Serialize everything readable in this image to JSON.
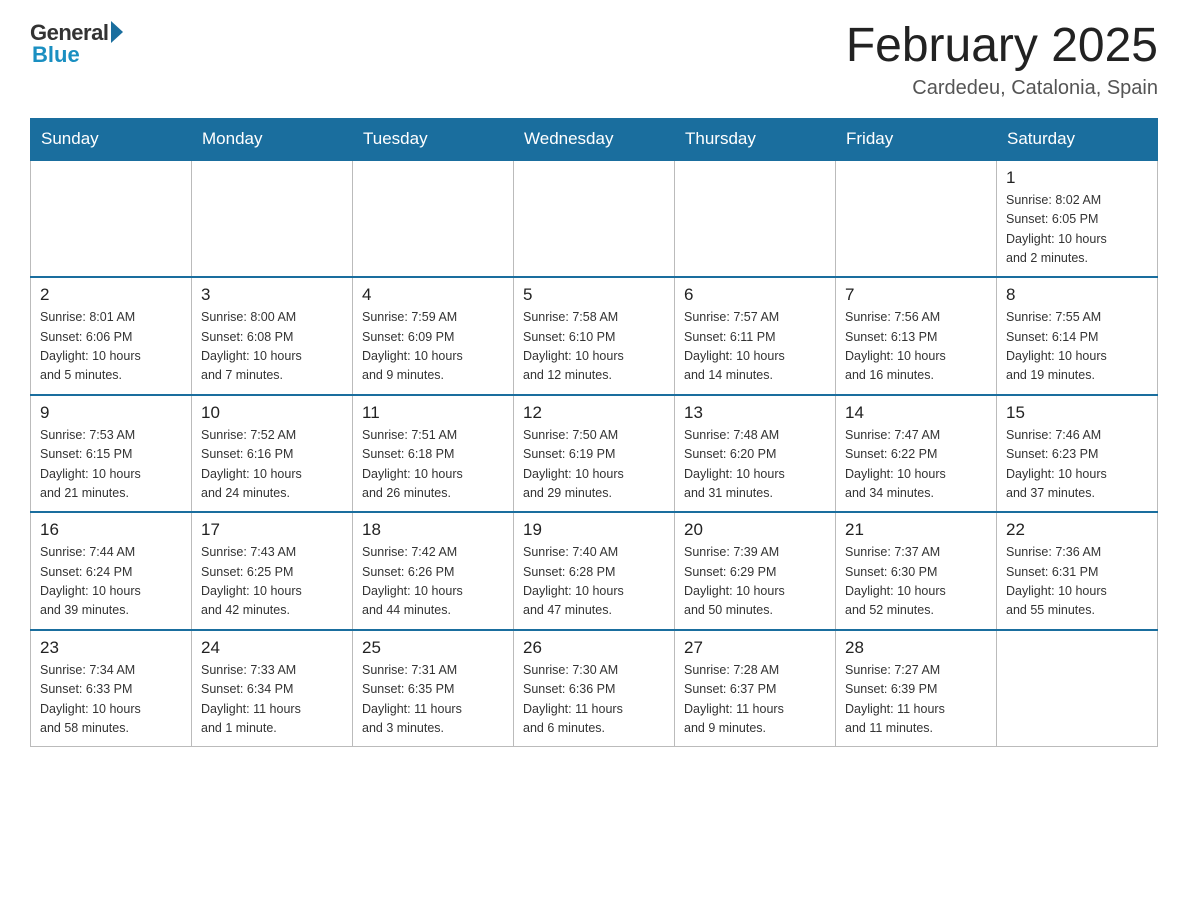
{
  "header": {
    "logo_general": "General",
    "logo_blue": "Blue",
    "month_title": "February 2025",
    "location": "Cardedeu, Catalonia, Spain"
  },
  "days_of_week": [
    "Sunday",
    "Monday",
    "Tuesday",
    "Wednesday",
    "Thursday",
    "Friday",
    "Saturday"
  ],
  "weeks": [
    [
      {
        "day": "",
        "info": ""
      },
      {
        "day": "",
        "info": ""
      },
      {
        "day": "",
        "info": ""
      },
      {
        "day": "",
        "info": ""
      },
      {
        "day": "",
        "info": ""
      },
      {
        "day": "",
        "info": ""
      },
      {
        "day": "1",
        "info": "Sunrise: 8:02 AM\nSunset: 6:05 PM\nDaylight: 10 hours\nand 2 minutes."
      }
    ],
    [
      {
        "day": "2",
        "info": "Sunrise: 8:01 AM\nSunset: 6:06 PM\nDaylight: 10 hours\nand 5 minutes."
      },
      {
        "day": "3",
        "info": "Sunrise: 8:00 AM\nSunset: 6:08 PM\nDaylight: 10 hours\nand 7 minutes."
      },
      {
        "day": "4",
        "info": "Sunrise: 7:59 AM\nSunset: 6:09 PM\nDaylight: 10 hours\nand 9 minutes."
      },
      {
        "day": "5",
        "info": "Sunrise: 7:58 AM\nSunset: 6:10 PM\nDaylight: 10 hours\nand 12 minutes."
      },
      {
        "day": "6",
        "info": "Sunrise: 7:57 AM\nSunset: 6:11 PM\nDaylight: 10 hours\nand 14 minutes."
      },
      {
        "day": "7",
        "info": "Sunrise: 7:56 AM\nSunset: 6:13 PM\nDaylight: 10 hours\nand 16 minutes."
      },
      {
        "day": "8",
        "info": "Sunrise: 7:55 AM\nSunset: 6:14 PM\nDaylight: 10 hours\nand 19 minutes."
      }
    ],
    [
      {
        "day": "9",
        "info": "Sunrise: 7:53 AM\nSunset: 6:15 PM\nDaylight: 10 hours\nand 21 minutes."
      },
      {
        "day": "10",
        "info": "Sunrise: 7:52 AM\nSunset: 6:16 PM\nDaylight: 10 hours\nand 24 minutes."
      },
      {
        "day": "11",
        "info": "Sunrise: 7:51 AM\nSunset: 6:18 PM\nDaylight: 10 hours\nand 26 minutes."
      },
      {
        "day": "12",
        "info": "Sunrise: 7:50 AM\nSunset: 6:19 PM\nDaylight: 10 hours\nand 29 minutes."
      },
      {
        "day": "13",
        "info": "Sunrise: 7:48 AM\nSunset: 6:20 PM\nDaylight: 10 hours\nand 31 minutes."
      },
      {
        "day": "14",
        "info": "Sunrise: 7:47 AM\nSunset: 6:22 PM\nDaylight: 10 hours\nand 34 minutes."
      },
      {
        "day": "15",
        "info": "Sunrise: 7:46 AM\nSunset: 6:23 PM\nDaylight: 10 hours\nand 37 minutes."
      }
    ],
    [
      {
        "day": "16",
        "info": "Sunrise: 7:44 AM\nSunset: 6:24 PM\nDaylight: 10 hours\nand 39 minutes."
      },
      {
        "day": "17",
        "info": "Sunrise: 7:43 AM\nSunset: 6:25 PM\nDaylight: 10 hours\nand 42 minutes."
      },
      {
        "day": "18",
        "info": "Sunrise: 7:42 AM\nSunset: 6:26 PM\nDaylight: 10 hours\nand 44 minutes."
      },
      {
        "day": "19",
        "info": "Sunrise: 7:40 AM\nSunset: 6:28 PM\nDaylight: 10 hours\nand 47 minutes."
      },
      {
        "day": "20",
        "info": "Sunrise: 7:39 AM\nSunset: 6:29 PM\nDaylight: 10 hours\nand 50 minutes."
      },
      {
        "day": "21",
        "info": "Sunrise: 7:37 AM\nSunset: 6:30 PM\nDaylight: 10 hours\nand 52 minutes."
      },
      {
        "day": "22",
        "info": "Sunrise: 7:36 AM\nSunset: 6:31 PM\nDaylight: 10 hours\nand 55 minutes."
      }
    ],
    [
      {
        "day": "23",
        "info": "Sunrise: 7:34 AM\nSunset: 6:33 PM\nDaylight: 10 hours\nand 58 minutes."
      },
      {
        "day": "24",
        "info": "Sunrise: 7:33 AM\nSunset: 6:34 PM\nDaylight: 11 hours\nand 1 minute."
      },
      {
        "day": "25",
        "info": "Sunrise: 7:31 AM\nSunset: 6:35 PM\nDaylight: 11 hours\nand 3 minutes."
      },
      {
        "day": "26",
        "info": "Sunrise: 7:30 AM\nSunset: 6:36 PM\nDaylight: 11 hours\nand 6 minutes."
      },
      {
        "day": "27",
        "info": "Sunrise: 7:28 AM\nSunset: 6:37 PM\nDaylight: 11 hours\nand 9 minutes."
      },
      {
        "day": "28",
        "info": "Sunrise: 7:27 AM\nSunset: 6:39 PM\nDaylight: 11 hours\nand 11 minutes."
      },
      {
        "day": "",
        "info": ""
      }
    ]
  ]
}
